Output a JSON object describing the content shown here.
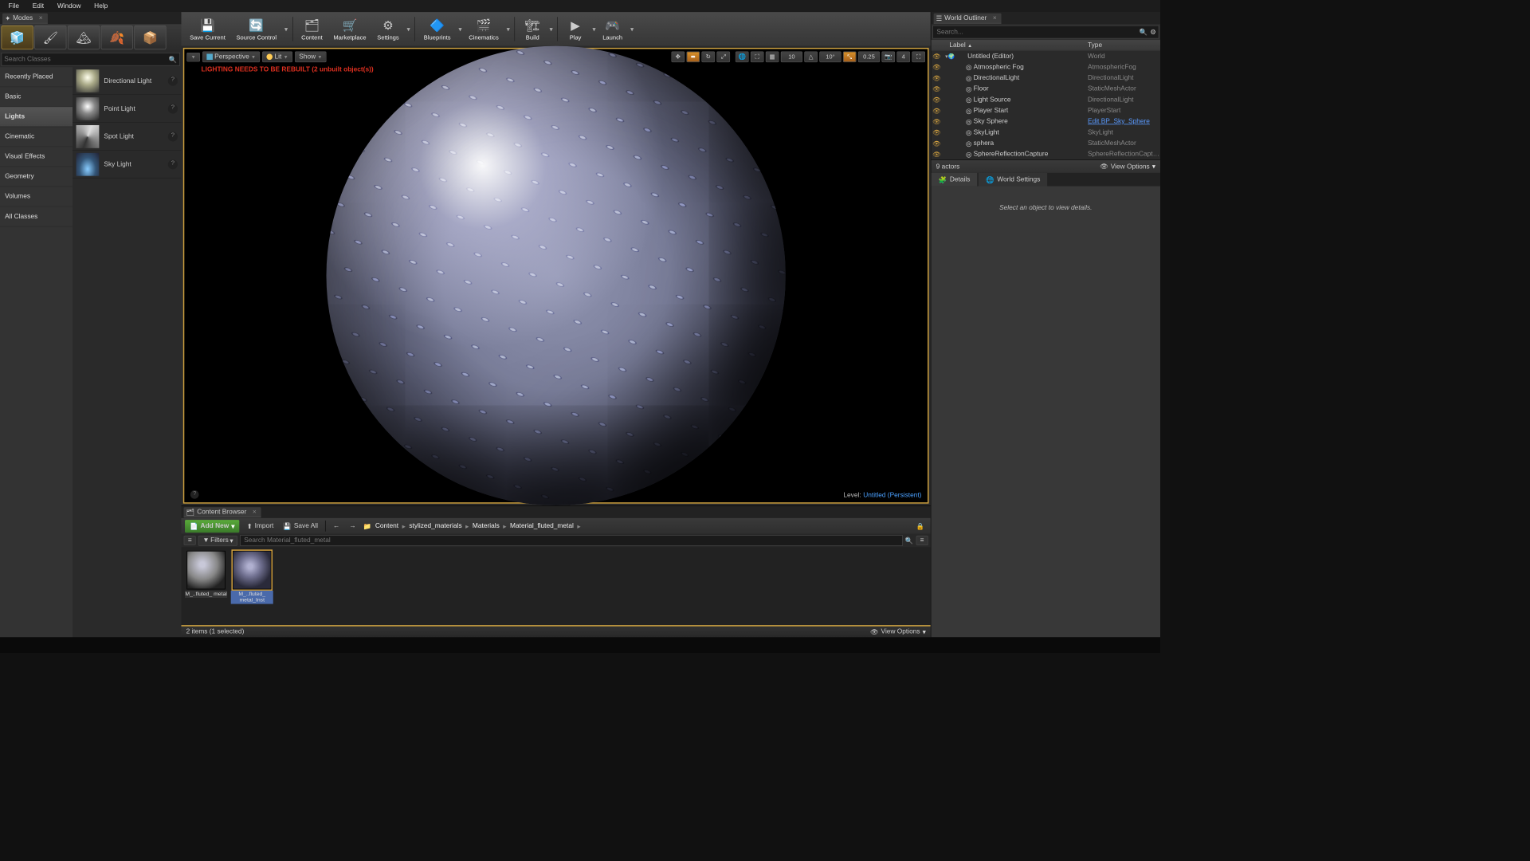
{
  "menubar": [
    "File",
    "Edit",
    "Window",
    "Help"
  ],
  "modes": {
    "tab": "Modes",
    "search_placeholder": "Search Classes",
    "categories": [
      "Recently Placed",
      "Basic",
      "Lights",
      "Cinematic",
      "Visual Effects",
      "Geometry",
      "Volumes",
      "All Classes"
    ],
    "selected_category": "Lights",
    "lights": [
      {
        "label": "Directional Light"
      },
      {
        "label": "Point Light"
      },
      {
        "label": "Spot Light"
      },
      {
        "label": "Sky Light"
      }
    ]
  },
  "toolbar": [
    {
      "label": "Save Current",
      "key": "save-current"
    },
    {
      "label": "Source Control",
      "key": "source-control",
      "dd": true
    },
    {
      "sep": true
    },
    {
      "label": "Content",
      "key": "content"
    },
    {
      "label": "Marketplace",
      "key": "marketplace"
    },
    {
      "label": "Settings",
      "key": "settings",
      "dd": true
    },
    {
      "sep": true
    },
    {
      "label": "Blueprints",
      "key": "blueprints",
      "dd": true
    },
    {
      "label": "Cinematics",
      "key": "cinematics",
      "dd": true
    },
    {
      "sep": true
    },
    {
      "label": "Build",
      "key": "build",
      "dd": true
    },
    {
      "sep": true
    },
    {
      "label": "Play",
      "key": "play",
      "dd": true
    },
    {
      "label": "Launch",
      "key": "launch",
      "dd": true
    }
  ],
  "viewport": {
    "perspective": "Perspective",
    "lit": "Lit",
    "show": "Show",
    "warning": "LIGHTING NEEDS TO BE REBUILT (2 unbuilt object(s))",
    "right_vals": {
      "angle": "10°",
      "scale": "0.25",
      "cam": "4",
      "grid": "10"
    },
    "level_label": "Level:",
    "level_name": "Untitled (Persistent)"
  },
  "outliner": {
    "tab": "World Outliner",
    "search_placeholder": "Search...",
    "col1": "Label",
    "col2": "Type",
    "rows": [
      {
        "label": "Untitled (Editor)",
        "type": "World",
        "top": true
      },
      {
        "label": "Atmospheric Fog",
        "type": "AtmosphericFog"
      },
      {
        "label": "DirectionalLight",
        "type": "DirectionalLight"
      },
      {
        "label": "Floor",
        "type": "StaticMeshActor"
      },
      {
        "label": "Light Source",
        "type": "DirectionalLight"
      },
      {
        "label": "Player Start",
        "type": "PlayerStart"
      },
      {
        "label": "Sky Sphere",
        "type": "Edit BP_Sky_Sphere",
        "link": true
      },
      {
        "label": "SkyLight",
        "type": "SkyLight"
      },
      {
        "label": "sphera",
        "type": "StaticMeshActor"
      },
      {
        "label": "SphereReflectionCapture",
        "type": "SphereReflectionCapture"
      }
    ],
    "footer_count": "9 actors",
    "view_options": "View Options"
  },
  "details": {
    "tabs": [
      "Details",
      "World Settings"
    ],
    "empty": "Select an object to view details."
  },
  "content_browser": {
    "tab": "Content Browser",
    "add_new": "Add New",
    "import": "Import",
    "save_all": "Save All",
    "filters": "Filters",
    "search_placeholder": "Search Material_fluted_metal",
    "breadcrumb": [
      "Content",
      "stylized_materials",
      "Materials",
      "Material_fluted_metal"
    ],
    "assets": [
      {
        "label": "M_..fluted_\nmetal"
      },
      {
        "label": "M_..fluted_\nmetal_Inst",
        "sel": true
      }
    ],
    "footer": "2 items (1 selected)",
    "view_options": "View Options"
  }
}
